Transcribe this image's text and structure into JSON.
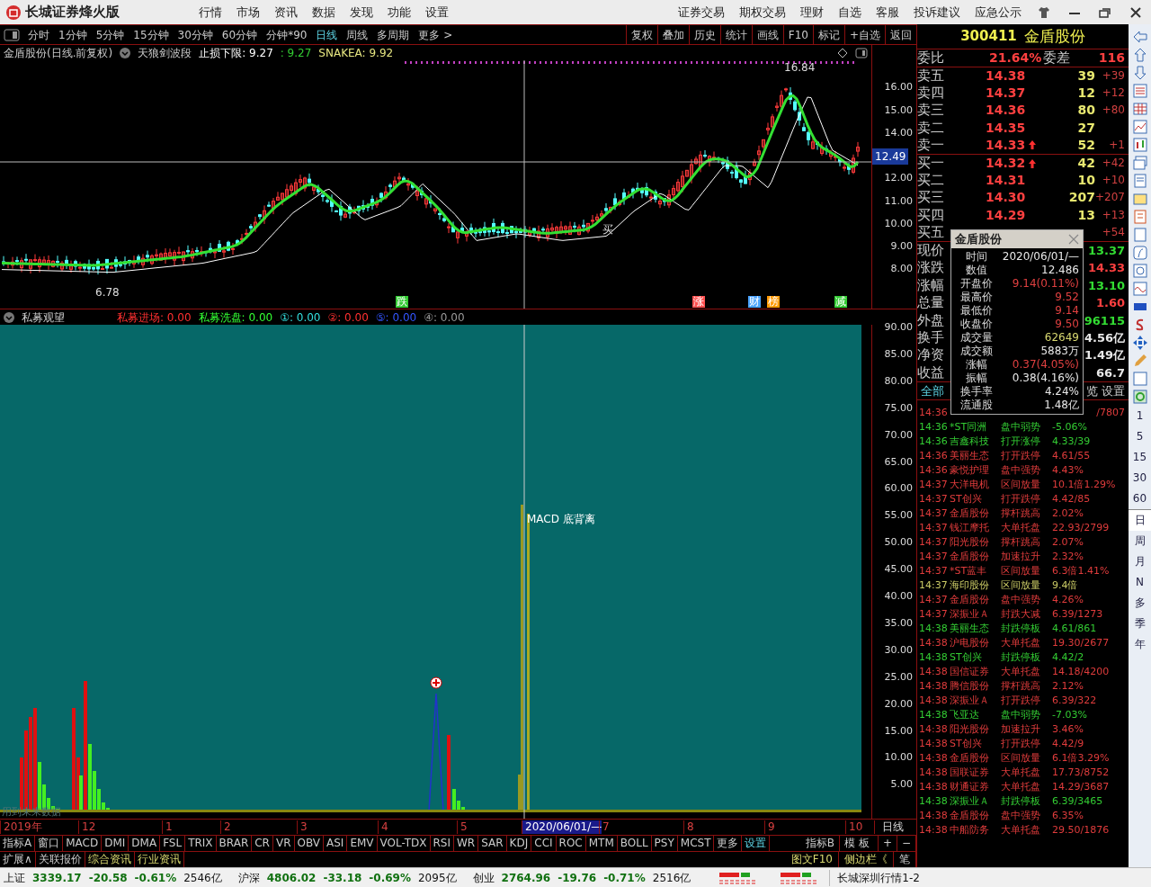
{
  "app": {
    "title": "长城证券烽火版",
    "menu": [
      "行情",
      "市场",
      "资讯",
      "数据",
      "发现",
      "功能",
      "设置"
    ],
    "right_menu": [
      "证券交易",
      "期权交易",
      "理财",
      "自选",
      "客服",
      "投诉建议",
      "应急公示"
    ]
  },
  "period_tabs": [
    {
      "label": "分时",
      "selected": false
    },
    {
      "label": "1分钟",
      "selected": false
    },
    {
      "label": "5分钟",
      "selected": false
    },
    {
      "label": "15分钟",
      "selected": false
    },
    {
      "label": "30分钟",
      "selected": false
    },
    {
      "label": "60分钟",
      "selected": false
    },
    {
      "label": "分钟*90",
      "selected": false
    },
    {
      "label": "日线",
      "selected": true
    },
    {
      "label": "周线",
      "selected": false
    },
    {
      "label": "多周期",
      "selected": false
    },
    {
      "label": "更多 >",
      "selected": false
    }
  ],
  "chart_buttons": [
    "复权",
    "叠加",
    "历史",
    "统计",
    "画线",
    "F10",
    "标记",
    "+自选",
    "返回"
  ],
  "price_chart": {
    "stock_label": "金盾股份(日线.前复权)",
    "indicator_name": "天狼剑波段",
    "readings": [
      {
        "text": "止损下限: 9.27",
        "color": "#ffffff"
      },
      {
        "text": ": 9.27",
        "color": "#33cc33"
      },
      {
        "text": "SNAKEA: 9.92",
        "color": "#e6e680"
      }
    ],
    "high_label": "16.84",
    "low_label": "6.78",
    "signal_label": "买",
    "cursor_price": "12.49",
    "y_labels": [
      "16.00",
      "15.00",
      "14.00",
      "12.00",
      "11.00",
      "10.00",
      "9.00",
      "8.00"
    ],
    "event_marks": [
      {
        "text": "跌",
        "color": "#33cc33"
      },
      {
        "text": "涨",
        "color": "#ff5050"
      },
      {
        "text": "财",
        "color": "#4aa3ff"
      },
      {
        "text": "榜",
        "color": "#ff9900"
      },
      {
        "text": "减",
        "color": "#33cc33"
      }
    ]
  },
  "indicator_chart": {
    "name": "私募观望",
    "readings": [
      {
        "text": "私募进场: 0.00",
        "color": "#ff3030"
      },
      {
        "text": "私募洗盘: 0.00",
        "color": "#33ff33"
      },
      {
        "text": "①: 0.00",
        "color": "#33dddd"
      },
      {
        "text": "②: 0.00",
        "color": "#ff3030"
      },
      {
        "text": "⑤: 0.00",
        "color": "#3355ff"
      },
      {
        "text": "④: 0.00",
        "color": "#999999"
      }
    ],
    "annotation": "MACD 底背离",
    "footnote": "用到未来数据",
    "y_labels": [
      "90.00",
      "85.00",
      "80.00",
      "75.00",
      "70.00",
      "65.00",
      "60.00",
      "55.00",
      "50.00",
      "45.00",
      "40.00",
      "35.00",
      "30.00",
      "25.00",
      "20.00",
      "15.00",
      "10.00",
      "5.00"
    ]
  },
  "x_axis": [
    {
      "label": "2019年",
      "selected": false
    },
    {
      "label": "12",
      "selected": false
    },
    {
      "label": "1",
      "selected": false
    },
    {
      "label": "2",
      "selected": false
    },
    {
      "label": "3",
      "selected": false
    },
    {
      "label": "4",
      "selected": false
    },
    {
      "label": "5",
      "selected": false
    },
    {
      "label": "2020/06/01/—",
      "selected": true
    },
    {
      "label": "7",
      "selected": false
    },
    {
      "label": "8",
      "selected": false
    },
    {
      "label": "9",
      "selected": false
    },
    {
      "label": "10",
      "selected": false
    }
  ],
  "x_axis_period": "日线",
  "indicator_tabs": [
    "指标A",
    "窗口",
    "MACD",
    "DMI",
    "DMA",
    "FSL",
    "TRIX",
    "BRAR",
    "CR",
    "VR",
    "OBV",
    "ASI",
    "EMV",
    "VOL-TDX",
    "RSI",
    "WR",
    "SAR",
    "KDJ",
    "CCI",
    "ROC",
    "MTM",
    "BOLL",
    "PSY",
    "MCST",
    "更多",
    "设置"
  ],
  "indicator_tabs_right": [
    "指标B",
    "模板",
    "+",
    "−"
  ],
  "extension_tabs": [
    "扩展∧",
    "关联报价",
    "综合资讯",
    "行业资讯"
  ],
  "extension_tabs_right": [
    "图文F10",
    "侧边栏《",
    "笔"
  ],
  "quote_panel": {
    "code": "300411",
    "name": "金盾股份",
    "ratio_label": "委比",
    "ratio": "21.64%",
    "diff_label": "委差",
    "diff": "116",
    "sell": [
      {
        "label": "卖五",
        "price": "14.38",
        "volume": "39",
        "change": "+39",
        "arrow": false
      },
      {
        "label": "卖四",
        "price": "14.37",
        "volume": "12",
        "change": "+12",
        "arrow": false
      },
      {
        "label": "卖三",
        "price": "14.36",
        "volume": "80",
        "change": "+80",
        "arrow": false
      },
      {
        "label": "卖二",
        "price": "14.35",
        "volume": "27",
        "arrow": false
      },
      {
        "label": "卖一",
        "price": "14.33",
        "volume": "52",
        "change": "+1",
        "arrow": true
      }
    ],
    "buy": [
      {
        "label": "买一",
        "price": "14.32",
        "volume": "42",
        "change": "+42",
        "arrow": true
      },
      {
        "label": "买二",
        "price": "14.31",
        "volume": "10",
        "change": "+10",
        "arrow": false
      },
      {
        "label": "买三",
        "price": "14.30",
        "volume": "207",
        "change": "+207",
        "arrow": false
      },
      {
        "label": "买四",
        "price": "14.29",
        "volume": "13",
        "change": "+13",
        "arrow": false
      },
      {
        "label": "买五",
        "change": "+54",
        "arrow": false
      }
    ],
    "stats": [
      {
        "label": "现价",
        "value": "13.37",
        "color": "#33dd33"
      },
      {
        "label": "涨跌",
        "value": "14.33",
        "color": "#ff4040"
      },
      {
        "label": "涨幅",
        "value": "13.10",
        "color": "#33dd33"
      },
      {
        "label": "总量",
        "value": "1.60",
        "color": "#ff4040"
      },
      {
        "label": "外盘",
        "value": "96115",
        "color": "#33dd33"
      },
      {
        "label": "换手",
        "value": "4.56亿",
        "color": "#e8e8e8"
      },
      {
        "label": "净资",
        "value": "1.49亿",
        "color": "#e8e8e8"
      },
      {
        "label": "收益",
        "value": "66.7",
        "color": "#e8e8e8"
      }
    ],
    "tabs": [
      {
        "label": "全部",
        "selected": true
      },
      {
        "label": "览",
        "selected": false
      },
      {
        "label": "设置",
        "selected": false
      }
    ]
  },
  "event_feed": [
    {
      "time": "14:36",
      "value": "/7807",
      "color": "#e03c3c"
    },
    {
      "time": "14:36",
      "name": "*ST同洲",
      "event": "盘中弱势",
      "value": "-5.06%",
      "color": "#33cc33"
    },
    {
      "time": "14:36",
      "name": "吉鑫科技",
      "event": "打开涨停",
      "value": "4.33/39",
      "color": "#33cc33"
    },
    {
      "time": "14:36",
      "name": "美丽生态",
      "event": "打开跌停",
      "value": "4.61/55",
      "color": "#e03c3c"
    },
    {
      "time": "14:36",
      "name": "豪悦护理",
      "event": "盘中强势",
      "value": "4.43%",
      "color": "#e03c3c"
    },
    {
      "time": "14:37",
      "name": "大洋电机",
      "event": "区间放量",
      "value": "10.1倍1.29%",
      "color": "#e03c3c"
    },
    {
      "time": "14:37",
      "name": "ST创兴",
      "event": "打开跌停",
      "value": "4.42/85",
      "color": "#e03c3c"
    },
    {
      "time": "14:37",
      "name": "金盾股份",
      "event": "撑杆跳高",
      "value": "2.02%",
      "color": "#e03c3c"
    },
    {
      "time": "14:37",
      "name": "钱江摩托",
      "event": "大单托盘",
      "value": "22.93/2799",
      "color": "#e03c3c"
    },
    {
      "time": "14:37",
      "name": "阳光股份",
      "event": "撑杆跳高",
      "value": "2.07%",
      "color": "#e03c3c"
    },
    {
      "time": "14:37",
      "name": "金盾股份",
      "event": "加速拉升",
      "value": "2.32%",
      "color": "#e03c3c"
    },
    {
      "time": "14:37",
      "name": "*ST蓝丰",
      "event": "区间放量",
      "value": "6.3倍1.41%",
      "color": "#e03c3c"
    },
    {
      "time": "14:37",
      "name": "海印股份",
      "event": "区间放量",
      "value": "9.4倍",
      "color": "#cccc66"
    },
    {
      "time": "14:37",
      "name": "金盾股份",
      "event": "盘中强势",
      "value": "4.26%",
      "color": "#e03c3c"
    },
    {
      "time": "14:37",
      "name": "深振业Ａ",
      "event": "封跌大减",
      "value": "6.39/1273",
      "color": "#e03c3c"
    },
    {
      "time": "14:38",
      "name": "美丽生态",
      "event": "封跌停板",
      "value": "4.61/861",
      "color": "#33cc33"
    },
    {
      "time": "14:38",
      "name": "沪电股份",
      "event": "大单托盘",
      "value": "19.30/2677",
      "color": "#e03c3c"
    },
    {
      "time": "14:38",
      "name": "ST创兴",
      "event": "封跌停板",
      "value": "4.42/2",
      "color": "#33cc33"
    },
    {
      "time": "14:38",
      "name": "国信证券",
      "event": "大单托盘",
      "value": "14.18/4200",
      "color": "#e03c3c"
    },
    {
      "time": "14:38",
      "name": "腾信股份",
      "event": "撑杆跳高",
      "value": "2.12%",
      "color": "#e03c3c"
    },
    {
      "time": "14:38",
      "name": "深振业Ａ",
      "event": "打开跌停",
      "value": "6.39/322",
      "color": "#e03c3c"
    },
    {
      "time": "14:38",
      "name": "飞亚达",
      "event": "盘中弱势",
      "value": "-7.03%",
      "color": "#33cc33"
    },
    {
      "time": "14:38",
      "name": "阳光股份",
      "event": "加速拉升",
      "value": "3.46%",
      "color": "#e03c3c"
    },
    {
      "time": "14:38",
      "name": "ST创兴",
      "event": "打开跌停",
      "value": "4.42/9",
      "color": "#e03c3c"
    },
    {
      "time": "14:38",
      "name": "金盾股份",
      "event": "区间放量",
      "value": "6.1倍3.29%",
      "color": "#e03c3c"
    },
    {
      "time": "14:38",
      "name": "国联证券",
      "event": "大单托盘",
      "value": "17.73/8752",
      "color": "#e03c3c"
    },
    {
      "time": "14:38",
      "name": "财通证券",
      "event": "大单托盘",
      "value": "14.29/3687",
      "color": "#e03c3c"
    },
    {
      "time": "14:38",
      "name": "深振业Ａ",
      "event": "封跌停板",
      "value": "6.39/3465",
      "color": "#33cc33"
    },
    {
      "time": "14:38",
      "name": "金盾股份",
      "event": "盘中强势",
      "value": "6.35%",
      "color": "#e03c3c"
    },
    {
      "time": "14:38",
      "name": "中船防务",
      "event": "大单托盘",
      "value": "29.50/1876",
      "color": "#e03c3c"
    }
  ],
  "tooltip": {
    "title": "金盾股份",
    "rows": [
      {
        "label": "时间",
        "value": "2020/06/01/—",
        "color": "#e8e8e8"
      },
      {
        "label": "数值",
        "value": "12.486",
        "color": "#e8e8e8"
      },
      {
        "label": "开盘价",
        "value": "9.14(0.11%)",
        "color": "#e04040"
      },
      {
        "label": "最高价",
        "value": "9.52",
        "color": "#e04040"
      },
      {
        "label": "最低价",
        "value": "9.14",
        "color": "#e04040"
      },
      {
        "label": "收盘价",
        "value": "9.50",
        "color": "#e04040"
      },
      {
        "label": "成交量",
        "value": "62649",
        "color": "#d8d870"
      },
      {
        "label": "成交额",
        "value": "5883万",
        "color": "#e8e8e8"
      },
      {
        "label": "涨幅",
        "value": "0.37(4.05%)",
        "color": "#e04040"
      },
      {
        "label": "振幅",
        "value": "0.38(4.16%)",
        "color": "#e8e8e8"
      },
      {
        "label": "换手率",
        "value": "4.24%",
        "color": "#e8e8e8"
      },
      {
        "label": "流通股",
        "value": "1.48亿",
        "color": "#e8e8e8"
      }
    ]
  },
  "side_periods": [
    {
      "label": "1",
      "selected": false
    },
    {
      "label": "5",
      "selected": false
    },
    {
      "label": "15",
      "selected": false
    },
    {
      "label": "30",
      "selected": false
    },
    {
      "label": "60",
      "selected": false
    },
    {
      "label": "日",
      "selected": true
    },
    {
      "label": "周",
      "selected": false
    },
    {
      "label": "月",
      "selected": false
    },
    {
      "label": "N",
      "selected": false
    },
    {
      "label": "多",
      "selected": false
    },
    {
      "label": "季",
      "selected": false
    },
    {
      "label": "年",
      "selected": false
    }
  ],
  "status_bar": {
    "indices": [
      {
        "name": "上证",
        "value": "3339.17",
        "change": "-20.58",
        "percent": "-0.61%",
        "amount": "2546亿"
      },
      {
        "name": "沪深",
        "value": "4806.02",
        "change": "-33.18",
        "percent": "-0.69%",
        "amount": "2095亿"
      },
      {
        "name": "创业",
        "value": "2764.96",
        "change": "-19.76",
        "percent": "-0.71%",
        "amount": "2516亿"
      }
    ],
    "server": "长城深圳行情1-2"
  }
}
